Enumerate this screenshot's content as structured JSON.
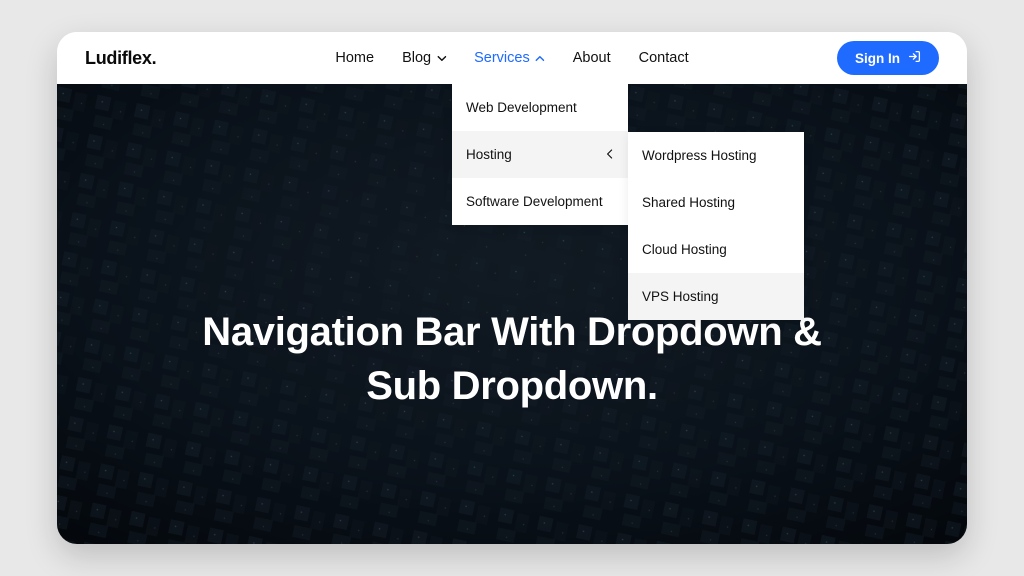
{
  "brand": "Ludiflex.",
  "nav": {
    "home": "Home",
    "blog": "Blog",
    "services": "Services",
    "about": "About",
    "contact": "Contact"
  },
  "signin_label": "Sign In",
  "hero_title_line1": "Navigation Bar With Dropdown &",
  "hero_title_line2": "Sub Dropdown.",
  "dropdown": {
    "web_dev": "Web Development",
    "hosting": "Hosting",
    "software_dev": "Software Development"
  },
  "sub_dropdown": {
    "wordpress": "Wordpress Hosting",
    "shared": "Shared Hosting",
    "cloud": "Cloud Hosting",
    "vps": "VPS Hosting"
  },
  "colors": {
    "accent": "#1f6bff"
  }
}
